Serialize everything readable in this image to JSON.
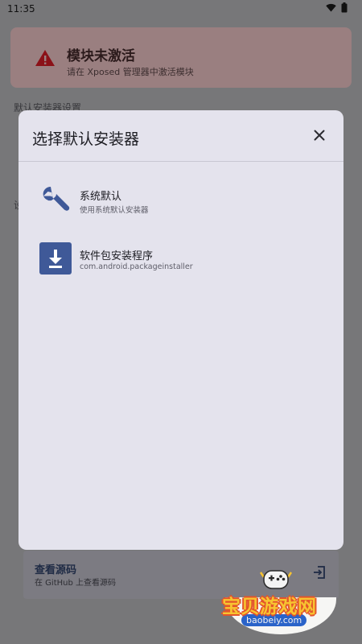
{
  "status_bar": {
    "time": "11:35"
  },
  "alert": {
    "title": "模块未激活",
    "subtitle": "请在 Xposed 管理器中激活模块"
  },
  "background": {
    "section_label": "默认安装器设置",
    "section_fragment": "设",
    "source_card": {
      "title": "查看源码",
      "subtitle": "在 GitHub 上查看源码"
    }
  },
  "dialog": {
    "title": "选择默认安装器",
    "options": [
      {
        "title": "系统默认",
        "subtitle": "使用系统默认安装器",
        "icon": "wrench-icon"
      },
      {
        "title": "软件包安装程序",
        "subtitle": "com.android.packageinstaller",
        "icon": "download-icon"
      }
    ]
  },
  "watermark": {
    "text": "宝贝游戏网",
    "url": "baobeiy.com"
  },
  "colors": {
    "scrim": "#777779",
    "dialog_bg": "#e4e3ed",
    "accent": "#3f5998",
    "alert_bg": "#9a7f80",
    "alert_icon": "#8b1118"
  }
}
